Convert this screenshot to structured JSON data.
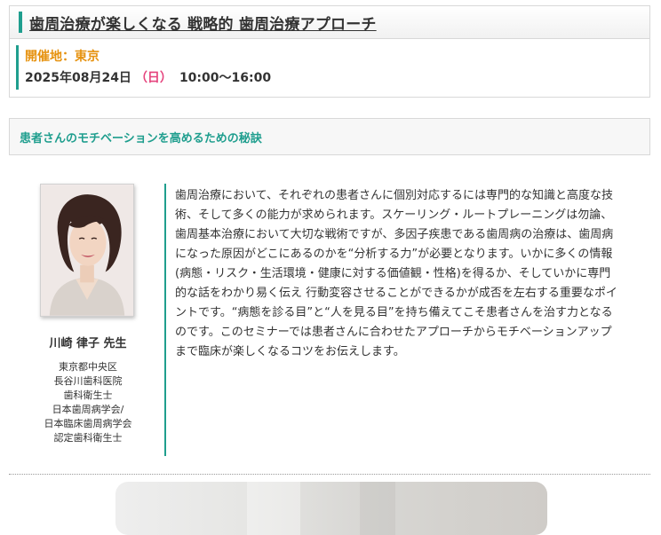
{
  "seminar": {
    "title": "歯周治療が楽しくなる 戦略的 歯周治療アプローチ",
    "venue": "開催地：東京",
    "date": "2025年08月24日",
    "day_of_week": "（日）",
    "time": "10:00～16:00"
  },
  "section": {
    "subtitle": "患者さんのモチベーションを高めるための秘訣"
  },
  "speaker": {
    "name": "川崎 律子 先生",
    "affiliation": [
      "東京都中央区",
      "長谷川歯科医院",
      "歯科衛生士",
      "日本歯周病学会/",
      "日本臨床歯周病学会",
      "認定歯科衛生士"
    ]
  },
  "description": "歯周治療において、それぞれの患者さんに個別対応するには専門的な知識と高度な技\n術、そして多くの能力が求められます。スケーリング・ルートプレーニングは勿論、\n歯周基本治療において大切な戦術ですが、多因子疾患である歯周病の治療は、歯周病\nになった原因がどこにあるのかを“分析する力”が必要となります。いかに多くの情報\n(病態・リスク・生活環境・健康に対する価値観・性格)を得るか、そしていかに専門\n的な話をわかり易く伝え 行動変容させることができるかが成否を左右する重要なポイ\nントです。“病態を診る目”と“人を見る目”を持ち備えてこそ患者さんを治す力となる\nのです。このセミナーでは患者さんに合わせたアプローチからモチベーションアップ\nまで臨床が楽しくなるコツをお伝えします。",
  "colors": {
    "accent": "#1f9e8e",
    "venue": "#e6920f",
    "weekday": "#e5447d"
  }
}
